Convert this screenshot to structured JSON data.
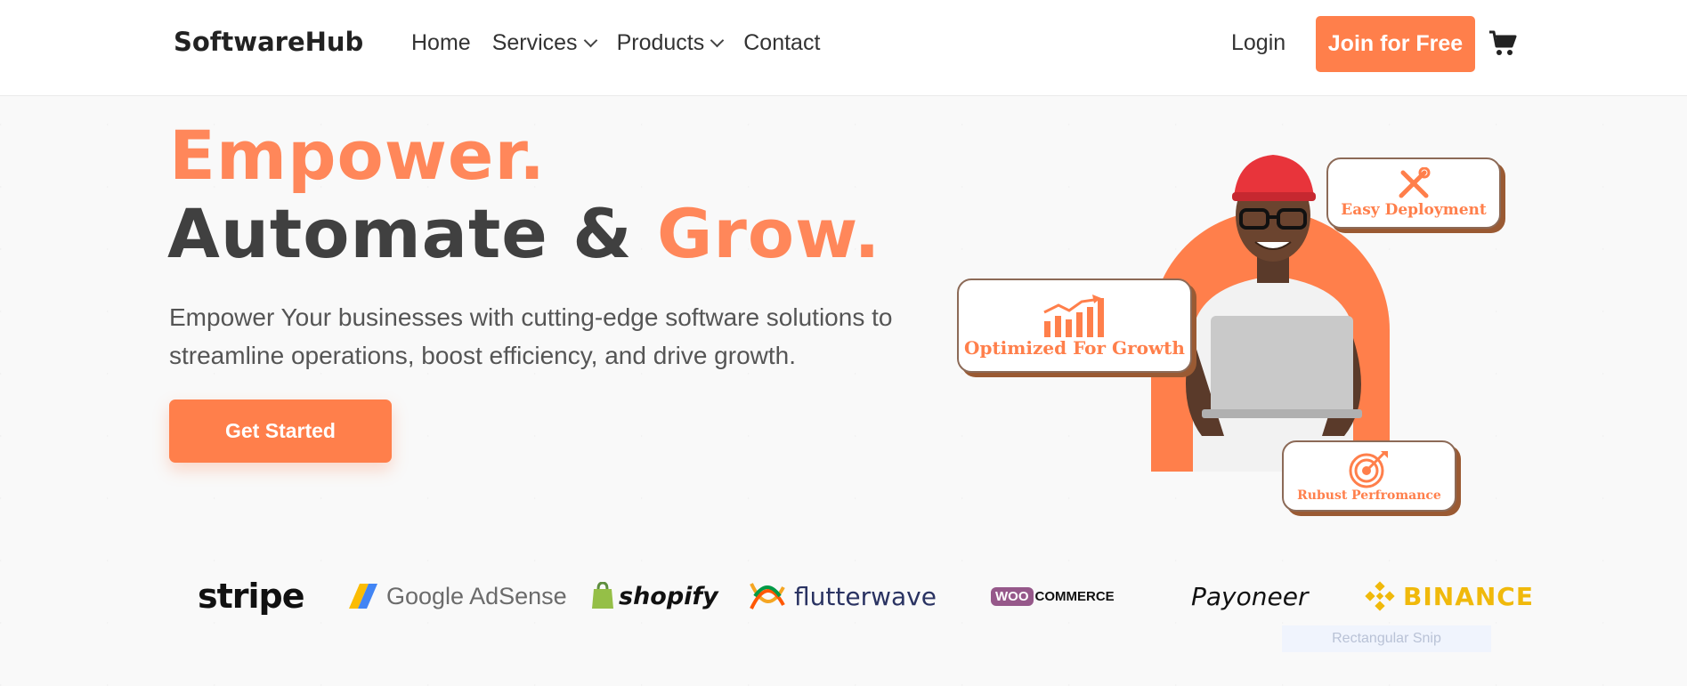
{
  "nav": {
    "brand": "SoftwareHub",
    "links": [
      "Home",
      "Services",
      "Products",
      "Contact"
    ],
    "login": "Login",
    "join": "Join for Free",
    "cart_icon": "cart-icon"
  },
  "hero": {
    "line1": "Empower.",
    "line2_main": "Automate & ",
    "line2_accent": "Grow.",
    "subtitle": "Empower Your businesses with cutting-edge software solutions to streamline operations, boost efficiency, and drive growth.",
    "cta": "Get Started",
    "badges": {
      "growth": "Optimized For Growth",
      "deploy": "Easy Deployment",
      "perf": "Rubust Perfromance"
    }
  },
  "logos": {
    "stripe": "stripe",
    "adsense": "Google AdSense",
    "shopify": "shopify",
    "flutterwave": "flutterwave",
    "woo": "WOO",
    "woocommerce": "COMMERCE",
    "payoneer": "Payoneer",
    "binance": "BINANCE"
  },
  "overlay": {
    "snip": "Rectangular Snip"
  },
  "colors": {
    "accent": "#ff7f4b",
    "heading_dark": "#404040",
    "binance": "#f0b90b"
  }
}
